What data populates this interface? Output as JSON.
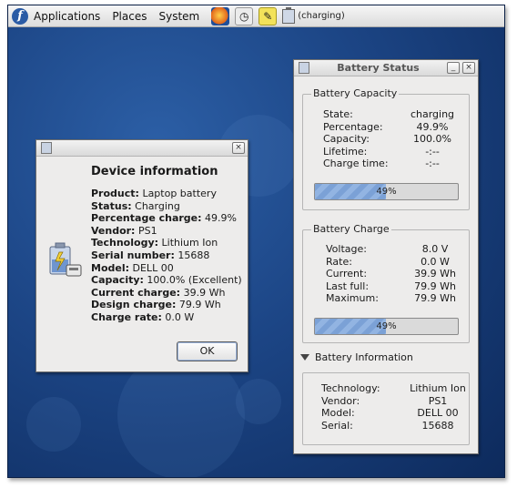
{
  "panel": {
    "menus": [
      "Applications",
      "Places",
      "System"
    ],
    "logo_glyph": "f",
    "launchers": [
      "firefox-icon",
      "clock-app-icon",
      "notes-icon"
    ],
    "battery_status": "(charging)"
  },
  "device_dialog": {
    "heading": "Device information",
    "rows": [
      {
        "key": "Product:",
        "value": "Laptop battery"
      },
      {
        "key": "Status:",
        "value": "Charging"
      },
      {
        "key": "Percentage charge:",
        "value": "49.9%"
      },
      {
        "key": "Vendor:",
        "value": "PS1"
      },
      {
        "key": "Technology:",
        "value": "Lithium Ion"
      },
      {
        "key": "Serial number:",
        "value": "15688"
      },
      {
        "key": "Model:",
        "value": "DELL 00"
      },
      {
        "key": "Capacity:",
        "value": "100.0% (Excellent)"
      },
      {
        "key": "Current charge:",
        "value": "39.9 Wh"
      },
      {
        "key": "Design charge:",
        "value": "79.9 Wh"
      },
      {
        "key": "Charge rate:",
        "value": "0.0 W"
      }
    ],
    "ok_label": "OK",
    "close_glyph": "×"
  },
  "battery_window": {
    "title": "Battery Status",
    "minimize_glyph": "_",
    "close_glyph": "×",
    "capacity": {
      "label": "Battery Capacity",
      "rows": [
        {
          "key": "State:",
          "value": "charging"
        },
        {
          "key": "Percentage:",
          "value": "49.9%"
        },
        {
          "key": "Capacity:",
          "value": "100.0%"
        },
        {
          "key": "Lifetime:",
          "value": "-:--"
        },
        {
          "key": "Charge time:",
          "value": "-:--"
        }
      ],
      "progress_text": "49%",
      "progress_fraction": 0.499
    },
    "charge": {
      "label": "Battery Charge",
      "rows": [
        {
          "key": "Voltage:",
          "value": "8.0 V"
        },
        {
          "key": "Rate:",
          "value": "0.0 W"
        },
        {
          "key": "Current:",
          "value": "39.9 Wh"
        },
        {
          "key": "Last full:",
          "value": "79.9 Wh"
        },
        {
          "key": "Maximum:",
          "value": "79.9 Wh"
        }
      ],
      "progress_text": "49%",
      "progress_fraction": 0.499
    },
    "information": {
      "label": "Battery Information",
      "rows": [
        {
          "key": "Technology:",
          "value": "Lithium Ion"
        },
        {
          "key": "Vendor:",
          "value": "PS1"
        },
        {
          "key": "Model:",
          "value": "DELL 00"
        },
        {
          "key": "Serial:",
          "value": "15688"
        }
      ]
    }
  }
}
